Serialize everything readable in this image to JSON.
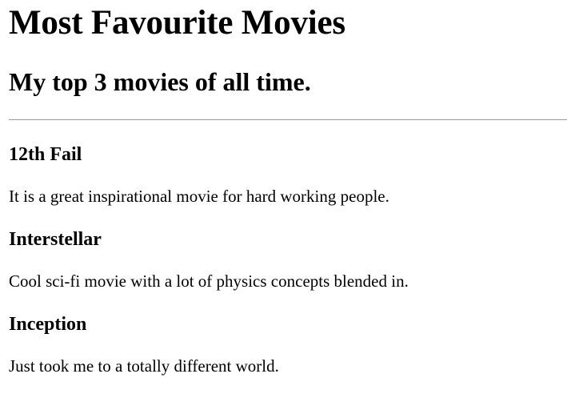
{
  "page": {
    "title": "Most Favourite Movies",
    "subtitle": "My top 3 movies of all time."
  },
  "movies": [
    {
      "title": "12th Fail",
      "description": "It is a great inspirational movie for hard working people."
    },
    {
      "title": "Interstellar",
      "description": "Cool sci-fi movie with a lot of physics concepts blended in."
    },
    {
      "title": "Inception",
      "description": "Just took me to a totally different world."
    }
  ]
}
